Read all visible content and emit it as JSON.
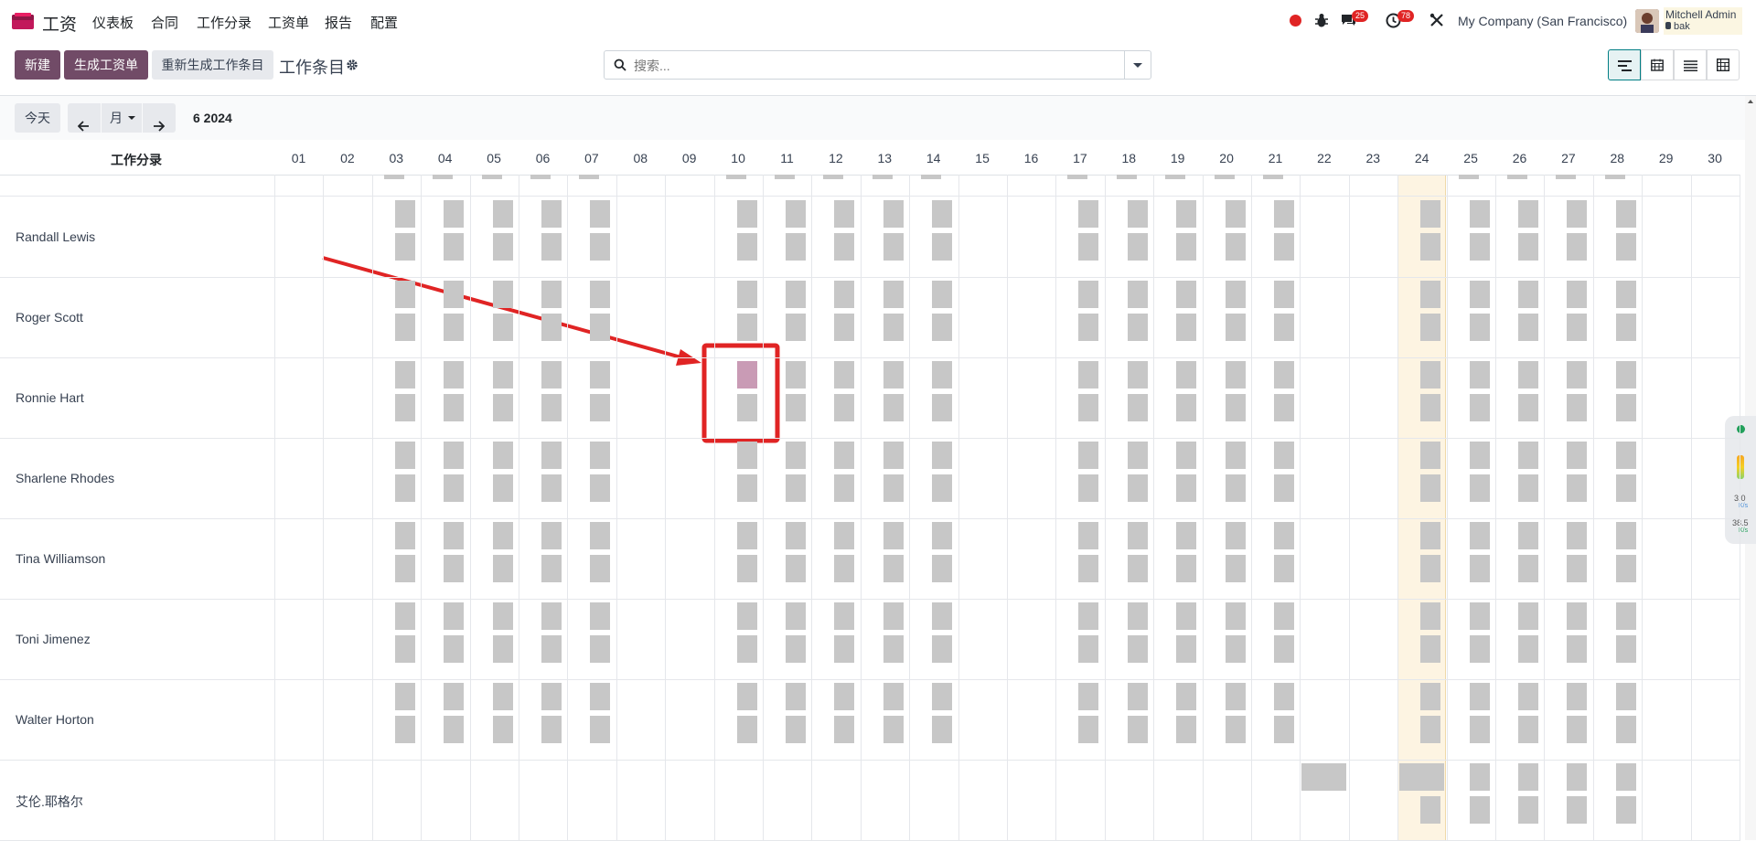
{
  "app": {
    "name": "工资"
  },
  "menu": [
    "仪表板",
    "合同",
    "工作分录",
    "工资单",
    "报告",
    "配置"
  ],
  "topbar": {
    "messages_count": "25",
    "activities_count": "78",
    "company": "My Company (San Francisco)",
    "user_name": "Mitchell Admin",
    "db_name": "bak"
  },
  "actions": {
    "new_label": "新建",
    "generate_label": "生成工资单",
    "regenerate_label": "重新生成工作条目",
    "page_title": "工作条目"
  },
  "search": {
    "placeholder": "搜索..."
  },
  "calendar_nav": {
    "today_label": "今天",
    "scale_label": "月",
    "period_label": "6 2024"
  },
  "gantt": {
    "group_header": "工作分录",
    "days": [
      "01",
      "02",
      "03",
      "04",
      "05",
      "06",
      "07",
      "08",
      "09",
      "10",
      "11",
      "12",
      "13",
      "14",
      "15",
      "16",
      "17",
      "18",
      "19",
      "20",
      "21",
      "22",
      "23",
      "24",
      "25",
      "26",
      "27",
      "28",
      "29",
      "30"
    ],
    "today": "24",
    "rows": [
      {
        "name": "Randall Lewis"
      },
      {
        "name": "Roger Scott"
      },
      {
        "name": "Ronnie Hart"
      },
      {
        "name": "Sharlene Rhodes"
      },
      {
        "name": "Tina Williamson"
      },
      {
        "name": "Toni Jimenez"
      },
      {
        "name": "Walter Horton"
      },
      {
        "name": "艾伦.耶格尔"
      }
    ],
    "work_days": [
      "03",
      "04",
      "05",
      "06",
      "07",
      "10",
      "11",
      "12",
      "13",
      "14",
      "17",
      "18",
      "19",
      "20",
      "21",
      "24",
      "25",
      "26",
      "27",
      "28"
    ],
    "highlighted_entry": {
      "employee": "Ronnie Hart",
      "day": "10",
      "slot": "morning"
    }
  },
  "network_widget": {
    "up": "3.0",
    "up_unit": "K/s",
    "down": "38.5",
    "down_unit": "K/s"
  },
  "colors": {
    "primary": "#714b67",
    "entry": "#c7c7c7",
    "highlight": "#c99bb5",
    "today_bg": "#fdf4e2",
    "annotation": "#e02424"
  }
}
